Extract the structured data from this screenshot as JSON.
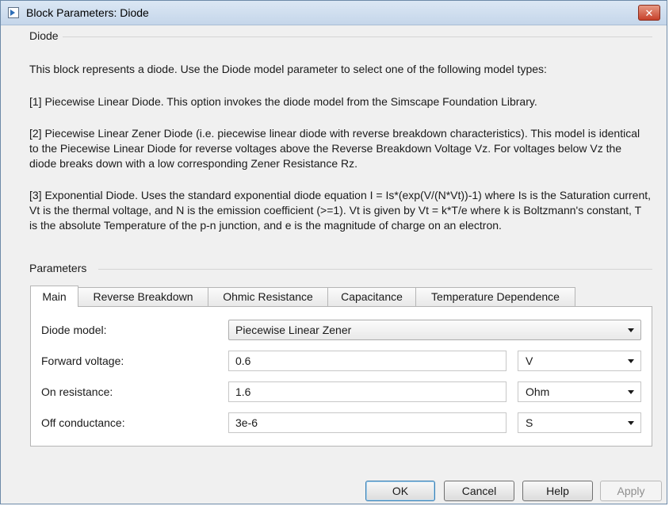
{
  "window": {
    "title": "Block Parameters: Diode",
    "close_glyph": "✕"
  },
  "block": {
    "name": "Diode",
    "description": [
      "This block represents a diode. Use the Diode model parameter to select one of the following model types:",
      "[1] Piecewise Linear Diode. This option invokes the diode model from the Simscape Foundation Library.",
      "[2] Piecewise Linear Zener Diode (i.e. piecewise linear diode with reverse breakdown characteristics). This model is identical to the Piecewise Linear Diode for reverse voltages above the Reverse Breakdown Voltage Vz. For voltages below Vz the diode breaks down with a low corresponding Zener Resistance Rz.",
      "[3] Exponential Diode. Uses the standard exponential diode equation I = Is*(exp(V/(N*Vt))-1) where Is is the Saturation current, Vt is the thermal voltage, and N is the emission coefficient (>=1). Vt is given by Vt = k*T/e where k is Boltzmann's constant, T is the absolute Temperature of the p-n junction, and e is the magnitude of charge on an electron."
    ]
  },
  "parameters": {
    "label": "Parameters",
    "tabs": [
      {
        "label": "Main",
        "active": true
      },
      {
        "label": "Reverse Breakdown",
        "active": false
      },
      {
        "label": "Ohmic Resistance",
        "active": false
      },
      {
        "label": "Capacitance",
        "active": false
      },
      {
        "label": "Temperature Dependence",
        "active": false
      }
    ],
    "diode_model": {
      "label": "Diode model:",
      "value": "Piecewise Linear Zener"
    },
    "rows": [
      {
        "label": "Forward voltage:",
        "value": "0.6",
        "unit": "V"
      },
      {
        "label": "On resistance:",
        "value": "1.6",
        "unit": "Ohm"
      },
      {
        "label": "Off conductance:",
        "value": "3e-6",
        "unit": "S"
      }
    ]
  },
  "buttons": {
    "ok": "OK",
    "cancel": "Cancel",
    "help": "Help",
    "apply": "Apply"
  },
  "icons": {
    "title": "simulink-block-icon",
    "close": "close-icon",
    "dropdown": "chevron-down-icon"
  },
  "colors": {
    "titlebar": "#c5d6ea",
    "close_button": "#c7412a",
    "dialog_bg": "#f0f0f0",
    "default_button_border": "#3c7fb1"
  }
}
